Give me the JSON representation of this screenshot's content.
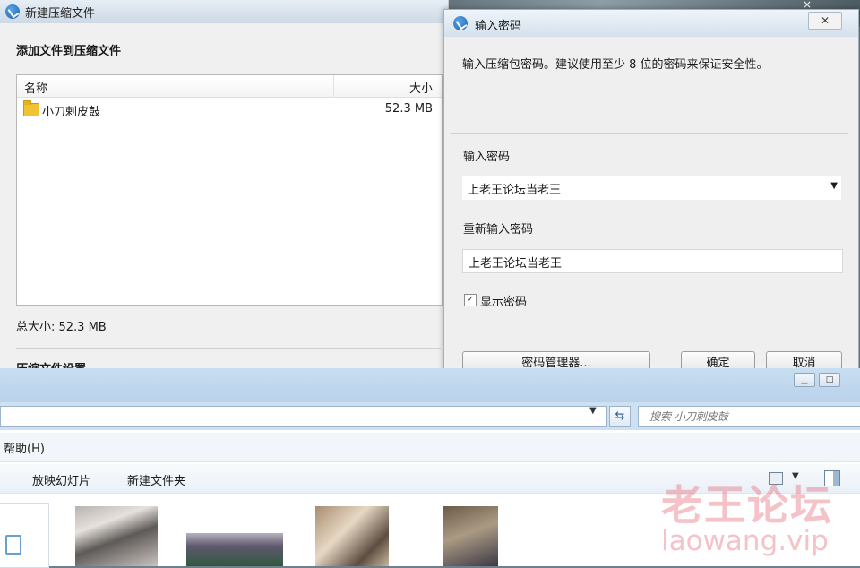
{
  "compress_window": {
    "title": "新建压缩文件",
    "heading": "添加文件到压缩文件",
    "columns": [
      "名称",
      "大小"
    ],
    "files": [
      {
        "name": "小刀剌皮鼓",
        "size": "52.3 MB"
      }
    ],
    "total_size": "总大小: 52.3 MB",
    "settings_heading": "压缩文件设置"
  },
  "password_dialog": {
    "title": "输入密码",
    "close_label": "✕",
    "message": "输入压缩包密码。建议使用至少 8 位的密码来保证安全性。",
    "password_label": "输入密码",
    "password_value": "上老王论坛当老王",
    "reenter_label": "重新输入密码",
    "reenter_value": "上老王论坛当老王",
    "show_password_label": "显示密码",
    "show_password_checked": true,
    "buttons": {
      "manager": "密码管理器...",
      "ok": "确定",
      "cancel": "取消"
    }
  },
  "explorer": {
    "search_placeholder": "搜索 小刀剌皮鼓",
    "menu": [
      "帮助(H)"
    ],
    "toolbar": {
      "slideshow": "放映幻灯片",
      "new_folder": "新建文件夹"
    }
  },
  "watermark": {
    "text": "老王论坛",
    "url": "laowang.vip"
  }
}
